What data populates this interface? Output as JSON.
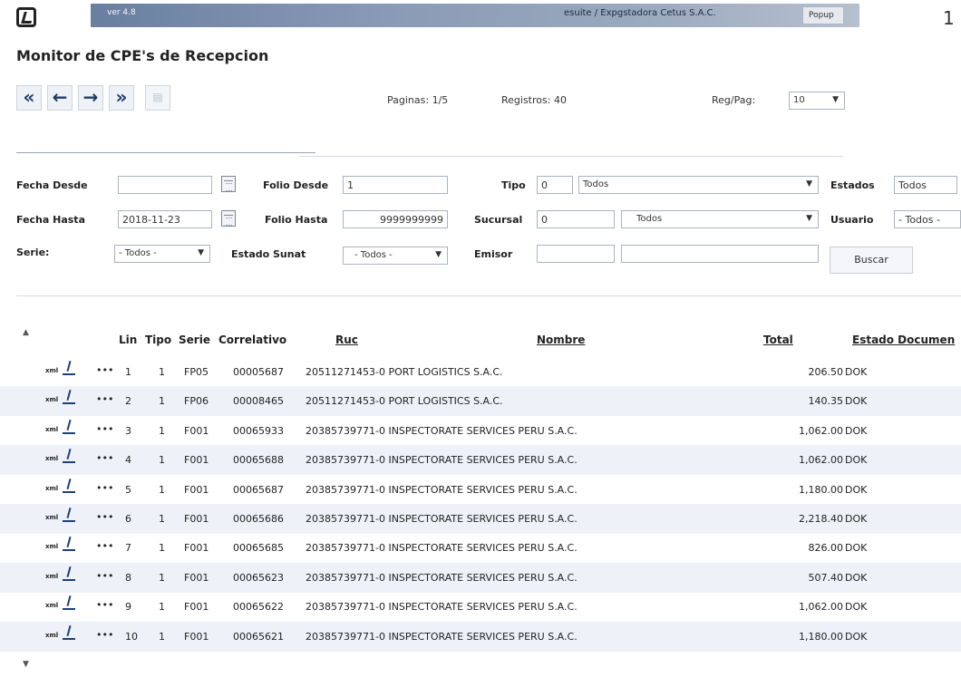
{
  "topbar": {
    "version": "ver 4.8",
    "tenant": "esuite / Expgstadora Cetus S.A.C.",
    "popup_label": "Popup",
    "page_number": "1"
  },
  "page_title": "Monitor de CPE's de Recepcion",
  "pager": {
    "first": "«",
    "prev": "←",
    "next": "→",
    "last": "»",
    "paginas": "Paginas: 1/5",
    "registros": "Registros: 40",
    "reg_pag_label": "Reg/Pag:",
    "reg_pag_value": "10"
  },
  "filters": {
    "fecha_desde_label": "Fecha Desde",
    "fecha_desde_value": "",
    "fecha_hasta_label": "Fecha Hasta",
    "fecha_hasta_value": "2018-11-23",
    "serie_label": "Serie:",
    "serie_value": "- Todos -",
    "folio_desde_label": "Folio Desde",
    "folio_desde_value": "1",
    "folio_hasta_label": "Folio Hasta",
    "folio_hasta_value": "9999999999",
    "estado_sunat_label": "Estado Sunat",
    "estado_sunat_value": "- Todos -",
    "tipo_label": "Tipo",
    "tipo_code": "0",
    "tipo_value": "Todos",
    "sucursal_label": "Sucursal",
    "sucursal_code": "0",
    "sucursal_value": "Todos",
    "emisor_label": "Emisor",
    "emisor_code": "",
    "emisor_value": "",
    "estados_label": "Estados",
    "estados_value": "Todos",
    "usuario_label": "Usuario",
    "usuario_value": "- Todos -",
    "buscar_label": "Buscar"
  },
  "table": {
    "headers": {
      "lin": "Lin",
      "tipo": "Tipo",
      "serie": "Serie",
      "correlativo": "Correlativo",
      "ruc": "Ruc",
      "nombre": "Nombre",
      "total": "Total",
      "estado": "Estado Documen"
    },
    "xml_label": "xml",
    "dots_label": "•••",
    "rows": [
      {
        "lin": "1",
        "tipo": "1",
        "serie": "FP05",
        "correlativo": "00005687",
        "ruc_nombre": "20511271453-0 PORT LOGISTICS S.A.C.",
        "total": "206.50",
        "estado": "DOK"
      },
      {
        "lin": "2",
        "tipo": "1",
        "serie": "FP06",
        "correlativo": "00008465",
        "ruc_nombre": "20511271453-0 PORT LOGISTICS S.A.C.",
        "total": "140.35",
        "estado": "DOK"
      },
      {
        "lin": "3",
        "tipo": "1",
        "serie": "F001",
        "correlativo": "00065933",
        "ruc_nombre": "20385739771-0 INSPECTORATE SERVICES PERU S.A.C.",
        "total": "1,062.00",
        "estado": "DOK"
      },
      {
        "lin": "4",
        "tipo": "1",
        "serie": "F001",
        "correlativo": "00065688",
        "ruc_nombre": "20385739771-0 INSPECTORATE SERVICES PERU S.A.C.",
        "total": "1,062.00",
        "estado": "DOK"
      },
      {
        "lin": "5",
        "tipo": "1",
        "serie": "F001",
        "correlativo": "00065687",
        "ruc_nombre": "20385739771-0 INSPECTORATE SERVICES PERU S.A.C.",
        "total": "1,180.00",
        "estado": "DOK"
      },
      {
        "lin": "6",
        "tipo": "1",
        "serie": "F001",
        "correlativo": "00065686",
        "ruc_nombre": "20385739771-0 INSPECTORATE SERVICES PERU S.A.C.",
        "total": "2,218.40",
        "estado": "DOK"
      },
      {
        "lin": "7",
        "tipo": "1",
        "serie": "F001",
        "correlativo": "00065685",
        "ruc_nombre": "20385739771-0 INSPECTORATE SERVICES PERU S.A.C.",
        "total": "826.00",
        "estado": "DOK"
      },
      {
        "lin": "8",
        "tipo": "1",
        "serie": "F001",
        "correlativo": "00065623",
        "ruc_nombre": "20385739771-0 INSPECTORATE SERVICES PERU S.A.C.",
        "total": "507.40",
        "estado": "DOK"
      },
      {
        "lin": "9",
        "tipo": "1",
        "serie": "F001",
        "correlativo": "00065622",
        "ruc_nombre": "20385739771-0 INSPECTORATE SERVICES PERU S.A.C.",
        "total": "1,062.00",
        "estado": "DOK"
      },
      {
        "lin": "10",
        "tipo": "1",
        "serie": "F001",
        "correlativo": "00065621",
        "ruc_nombre": "20385739771-0 INSPECTORATE SERVICES PERU S.A.C.",
        "total": "1,180.00",
        "estado": "DOK"
      }
    ]
  }
}
